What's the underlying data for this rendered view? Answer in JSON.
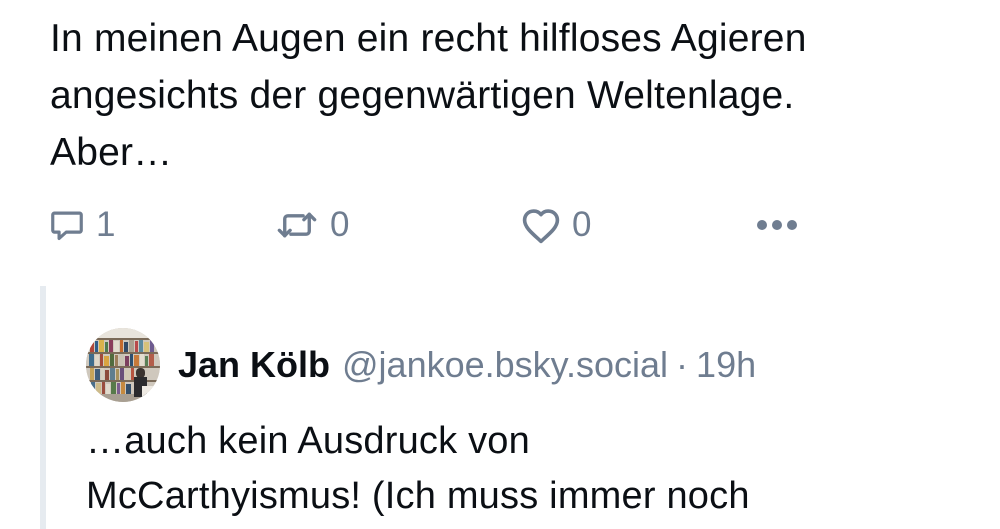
{
  "post": {
    "text_lines": [
      "In meinen Augen ein recht hilfloses Agieren",
      "angesichts der gegenwärtigen Weltenlage.",
      "Aber…"
    ],
    "actions": {
      "reply_count": "1",
      "repost_count": "0",
      "like_count": "0"
    }
  },
  "reply": {
    "author_name": "Jan Kölb",
    "author_handle": "@jankoe.bsky.social",
    "separator": "·",
    "timestamp": "19h",
    "text_lines": [
      "…auch kein Ausdruck von",
      "McCarthyismus! (Ich muss immer noch"
    ]
  },
  "colors": {
    "text": "#0b0f14",
    "muted": "#6f7d90",
    "thread_line": "#e6ebf0"
  },
  "icons": {
    "reply": "speech-bubble-icon",
    "repost": "repost-arrows-icon",
    "like": "heart-icon",
    "more": "ellipsis-icon"
  }
}
